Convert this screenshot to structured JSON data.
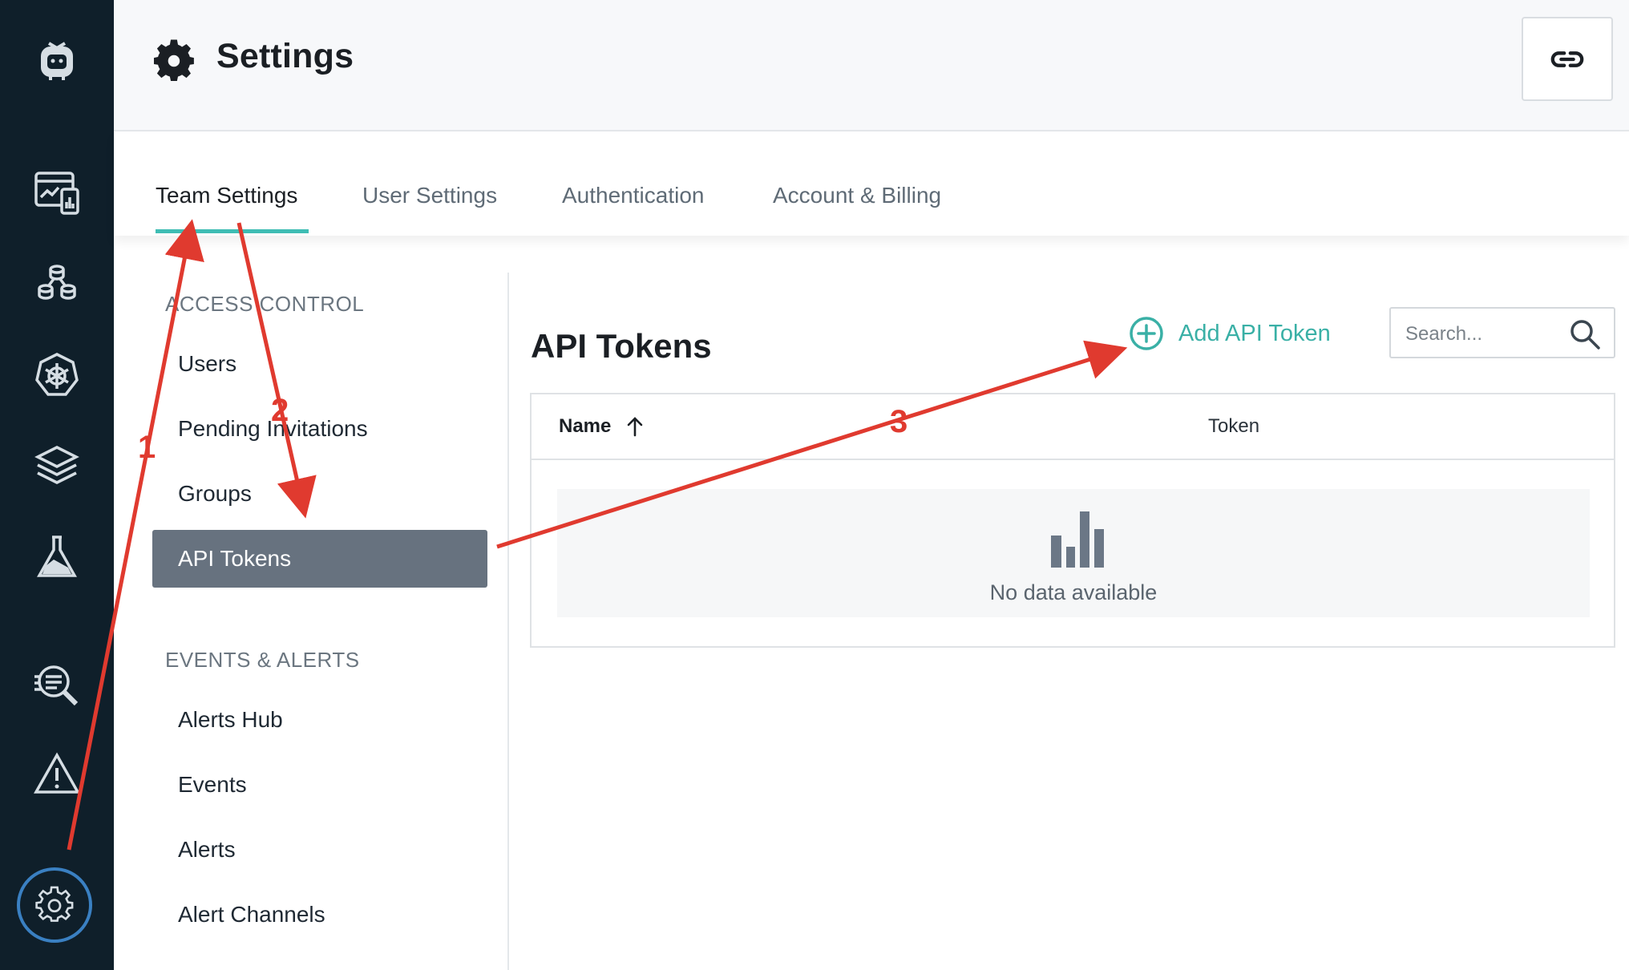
{
  "header": {
    "title": "Settings"
  },
  "tabs": [
    {
      "label": "Team Settings",
      "active": true
    },
    {
      "label": "User Settings",
      "active": false
    },
    {
      "label": "Authentication",
      "active": false
    },
    {
      "label": "Account & Billing",
      "active": false
    }
  ],
  "menu": {
    "sections": [
      {
        "title": "ACCESS CONTROL",
        "items": [
          "Users",
          "Pending Invitations",
          "Groups",
          "API Tokens"
        ]
      },
      {
        "title": "EVENTS & ALERTS",
        "items": [
          "Alerts Hub",
          "Events",
          "Alerts",
          "Alert Channels"
        ]
      }
    ],
    "active_item": "API Tokens"
  },
  "content": {
    "title": "API Tokens",
    "add_button_label": "Add API Token",
    "search": {
      "placeholder": "Search...",
      "value": ""
    },
    "table": {
      "columns": [
        {
          "label": "Name",
          "sort": "ascending"
        },
        {
          "label": "Token"
        }
      ],
      "rows": [],
      "empty_text": "No data available"
    }
  },
  "annotations": [
    "1",
    "2",
    "3"
  ],
  "colors": {
    "sidebar_bg": "#0f1f2a",
    "accent": "#3fbdb4",
    "active_menu_bg": "#67727f",
    "annotation": "#e03a2f",
    "settings_ring": "#3a80c2"
  },
  "sidebar_icons": [
    "bot-logo-icon",
    "dashboard-icon",
    "services-icon",
    "kubernetes-icon",
    "layers-icon",
    "flask-icon",
    "search-logs-icon",
    "warning-icon",
    "gear-icon"
  ]
}
